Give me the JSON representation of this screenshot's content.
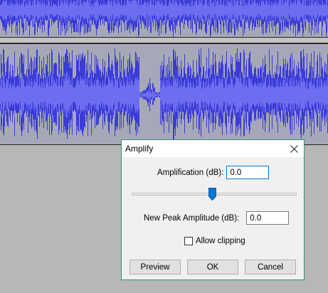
{
  "dialog": {
    "title": "Amplify",
    "amplification_label": "Amplification (dB):",
    "amplification_value": "0.0",
    "peak_label": "New Peak Amplitude (dB):",
    "peak_value": "0.0",
    "slider_level": 0.5,
    "allow_clipping_label": "Allow clipping",
    "allow_clipping_checked": false,
    "preview_label": "Preview",
    "ok_label": "OK",
    "cancel_label": "Cancel"
  },
  "colors": {
    "waveform": "#3b3bd6",
    "waveform_rms": "#6d6df0",
    "track_bg": "#a6a8b8"
  }
}
